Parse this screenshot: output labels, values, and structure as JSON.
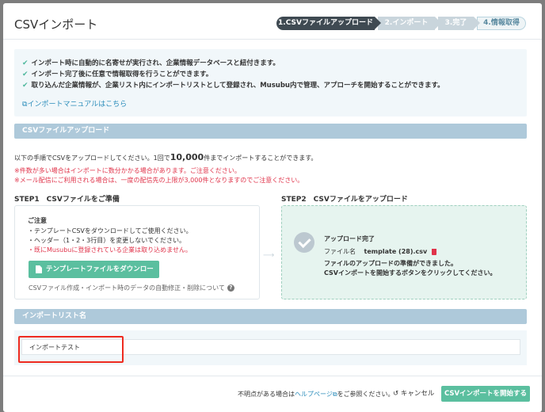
{
  "modal": {
    "title": "CSVインポート",
    "steps": [
      "1.CSVファイルアップロード",
      "2.インポート",
      "3.完了",
      "4.情報取得"
    ]
  },
  "info": {
    "lines": [
      "インポート時に自動的に名寄せが実行され、企業情報データベースと紐付きます。",
      "インポート完了後に任意で情報取得を行うことができます。",
      "取り込んだ企業情報が、企業リスト内にインポートリストとして登録され、Musubu内で管理、アプローチを開始することができます。"
    ],
    "manual_link": "インポートマニュアルはこちら"
  },
  "upload_section": {
    "header": "CSVファイルアップロード",
    "instruction_pre": "以下の手順でCSVをアップロードしてください。1回で",
    "instruction_num": "10,000",
    "instruction_post": "件までインポートすることができます。",
    "warning1": "※件数が多い場合はインポートに数分かかる場合があります。ご注意ください。",
    "warning2": "※メール配信にご利用される場合は、一度の配信先の上限が3,000件となりますのでご注意ください。"
  },
  "step1": {
    "title": "STEP1　CSVファイルをご準備",
    "note_title": "ご注意",
    "notes": [
      "・テンプレートCSVをダウンロードしてご使用ください。",
      "・ヘッダー（1・2・3行目）を変更しないでください。",
      "・既にMusubuに登録されている企業は取り込めません。"
    ],
    "download_button": "テンプレートファイルをダウンロード",
    "help_text": "CSVファイル作成・インポート時のデータの自動修正・削除について"
  },
  "step2": {
    "title": "STEP2　CSVファイルをアップロード",
    "status": "アップロード完了",
    "file_label": "ファイル名",
    "file_name": "template (28).csv",
    "message1": "ファイルのアップロードの準備ができました。",
    "message2": "CSVインポートを開始するボタンをクリックしてください。"
  },
  "list_section": {
    "header": "インポートリスト名",
    "input_value": "インポートテスト"
  },
  "footer": {
    "question_pre": "不明点がある場合は",
    "help_link": "ヘルプページ",
    "question_post": "をご参照ください。",
    "cancel": "キャンセル",
    "start": "CSVインポートを開始する"
  },
  "colors": {
    "accent_green": "#5bbf9f",
    "section_blue": "#aec9da",
    "step_active": "#3f4a52",
    "warning_red": "#e0334a",
    "highlight_red": "#ee2b20"
  }
}
